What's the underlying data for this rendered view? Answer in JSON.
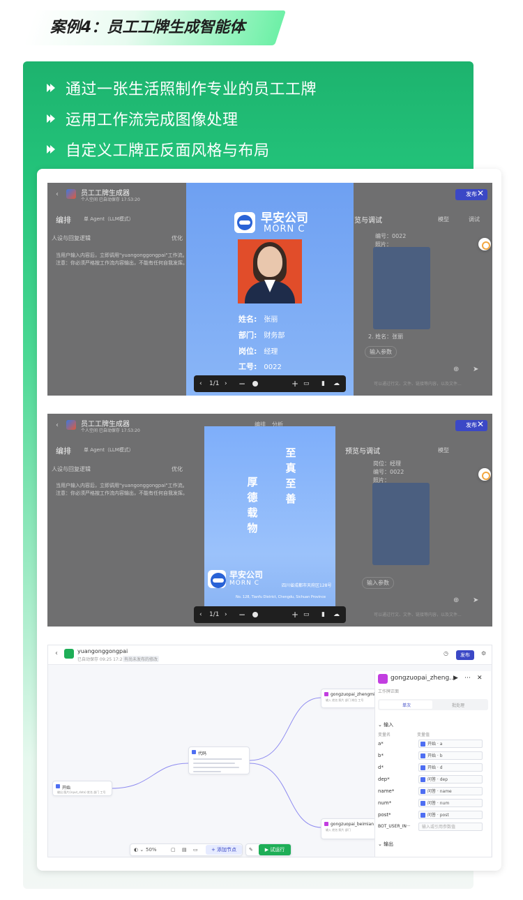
{
  "header": {
    "title": "案例4：员工工牌生成智能体"
  },
  "bullets": [
    "通过一张生活照制作专业的员工工牌",
    "运用工作流完成图像处理",
    "自定义工牌正反面风格与布局"
  ],
  "shot1": {
    "app_title": "员工工牌生成器",
    "app_meta": "个人空间  已自动保存 17:53:20",
    "arrange": "编排",
    "mode": "单 Agent（LLM模式）",
    "persona_label": "人设与回复逻辑",
    "optimize": "优化",
    "persona_text_1": "当用户输入内容后，立即调用\"yuangonggongpai\"工作流。",
    "persona_text_2": "注意：你必须严格按工作流内容输出，不能有任何自我发挥。",
    "preview_label": "览与调试",
    "model": "模型",
    "debug": "调试",
    "publish": "发布",
    "emp_no_line": "编号：0022",
    "photo_line": "照片：",
    "name_line": "2. 姓名：张丽",
    "input_params": "输入参数",
    "chat_hint": "可以通过行文、文件、链接等内容，以及文件...",
    "card": {
      "company": "早安公司",
      "company_en": "MORN C",
      "name_label": "姓名:",
      "name_value": "张丽",
      "dept_label": "部门:",
      "dept_value": "财务部",
      "post_label": "岗位:",
      "post_value": "经理",
      "num_label": "工号:",
      "num_value": "0022"
    },
    "toolbar": {
      "page": "1/1",
      "prev": "‹",
      "next": "›"
    }
  },
  "shot2": {
    "app_title": "员工工牌生成器",
    "app_meta": "个人空间  已自动保存 17:53:20",
    "tab_arrange": "编排",
    "tab_analysis": "分析",
    "arrange": "编排",
    "mode": "单 Agent（LLM模式）",
    "persona_label": "人设与回复逻辑",
    "optimize": "优化",
    "persona_text_1": "当用户输入内容后，立即调用\"yuangonggongpai\"工作流。",
    "persona_text_2": "注意：你必须严格按工作流内容输出，不能有任何自我发挥。",
    "preview_label": "预览与调试",
    "model": "模型",
    "publish": "发布",
    "post_line": "岗位：经理",
    "emp_no_line": "编号：0022",
    "photo_line": "照片：",
    "input_params": "输入参数",
    "chat_hint": "可以通过行文、文件、链接等内容，以及文件...",
    "back": {
      "motto_right": "至真至善",
      "motto_left": "厚德载物",
      "company": "早安公司",
      "company_en": "MORN C",
      "address_cn": "四川省成都市天府区128号",
      "address_en": "No. 128, Tianfu District, Chengdu, Sichuan Province"
    },
    "toolbar": {
      "page": "1/1",
      "prev": "‹",
      "next": "›"
    }
  },
  "shot3": {
    "app_title": "yuangonggongpai",
    "app_meta": "已自动保存 09:25 17:23:53",
    "unpublished": "有尚未发布的修改",
    "publish": "发布",
    "node_start": "开始",
    "node_start_sub": "输出  图片(input_data)  姓名  部门  工号",
    "node_mid": "代码",
    "node_top": "gongzuopai_zhengmian",
    "node_top_sub": "输入  姓名  照片  部门  岗位  工号",
    "node_bottom": "gongzuopai_beimian",
    "node_bottom_sub": "输入  姓名  照片  部门",
    "panel_title": "gongzuopai_zheng...",
    "panel_sub": "工作牌正面",
    "tab_single": "单次",
    "tab_batch": "批处理",
    "input_section": "输入",
    "col_name": "变量名",
    "col_value": "变量值",
    "rows": [
      {
        "name": "a*",
        "value": "开始 · a"
      },
      {
        "name": "b*",
        "value": "开始 · b"
      },
      {
        "name": "d*",
        "value": "开始 · d"
      },
      {
        "name": "dep*",
        "value": "问答 · dep"
      },
      {
        "name": "name*",
        "value": "问答 · name"
      },
      {
        "name": "num*",
        "value": "问答 · num"
      },
      {
        "name": "post*",
        "value": "问答 · post"
      }
    ],
    "bot_user_label": "BOT_USER_IN···",
    "bot_user_placeholder": "输入或引用参数值",
    "output_section": "输出",
    "zoom": "50%",
    "add_node": "添加节点",
    "run_test": "试运行"
  },
  "colors": {
    "green": "#1db36e",
    "publish_blue": "#3b48c6",
    "card_blue": "#7aa9f4",
    "photo_red": "#e14d2a",
    "run_green": "#1eae57"
  }
}
